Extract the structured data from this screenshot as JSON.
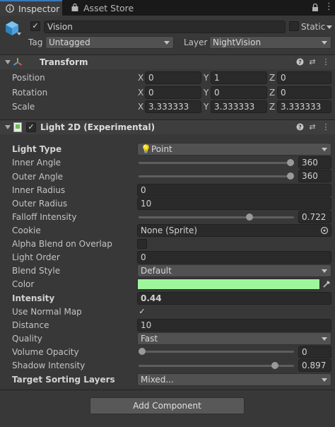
{
  "tabs": [
    {
      "label": "Inspector",
      "icon": "info-icon"
    },
    {
      "label": "Asset Store",
      "icon": "shopping-bag-icon"
    }
  ],
  "header": {
    "object_name": "Vision",
    "static_label": "Static",
    "tag_label": "Tag",
    "tag_value": "Untagged",
    "layer_label": "Layer",
    "layer_value": "NightVision"
  },
  "transform": {
    "title": "Transform",
    "rows": [
      {
        "label": "Position",
        "x": "0",
        "y": "1",
        "z": "0"
      },
      {
        "label": "Rotation",
        "x": "0",
        "y": "0",
        "z": "0"
      },
      {
        "label": "Scale",
        "x": "3.333333",
        "y": "3.333333",
        "z": "3.333333"
      }
    ],
    "axis": {
      "x": "X",
      "y": "Y",
      "z": "Z"
    }
  },
  "light2d": {
    "title": "Light 2D (Experimental)",
    "light_type_label": "Light Type",
    "light_type_value": "Point",
    "inner_angle_label": "Inner Angle",
    "inner_angle_value": "360",
    "inner_angle_fraction": 1.0,
    "outer_angle_label": "Outer Angle",
    "outer_angle_value": "360",
    "outer_angle_fraction": 1.0,
    "inner_radius_label": "Inner Radius",
    "inner_radius_value": "0",
    "outer_radius_label": "Outer Radius",
    "outer_radius_value": "10",
    "falloff_label": "Falloff Intensity",
    "falloff_value": "0.722",
    "falloff_fraction": 0.722,
    "cookie_label": "Cookie",
    "cookie_value": "None (Sprite)",
    "alpha_blend_label": "Alpha Blend on Overlap",
    "alpha_blend_checked": false,
    "light_order_label": "Light Order",
    "light_order_value": "0",
    "blend_style_label": "Blend Style",
    "blend_style_value": "Default",
    "color_label": "Color",
    "color_value": "#9ef59c",
    "intensity_label": "Intensity",
    "intensity_value": "0.44",
    "normal_map_label": "Use Normal Map",
    "normal_map_checked": true,
    "distance_label": "Distance",
    "distance_value": "10",
    "quality_label": "Quality",
    "quality_value": "Fast",
    "volume_opacity_label": "Volume Opacity",
    "volume_opacity_value": "0",
    "volume_opacity_fraction": 0.0,
    "shadow_intensity_label": "Shadow Intensity",
    "shadow_intensity_value": "0.897",
    "shadow_intensity_fraction": 0.897,
    "sorting_layers_label": "Target Sorting Layers",
    "sorting_layers_value": "Mixed..."
  },
  "add_component_label": "Add Component",
  "colors": {
    "accent": "#3a79bb",
    "background": "#383838",
    "field": "#2a2a2a"
  }
}
